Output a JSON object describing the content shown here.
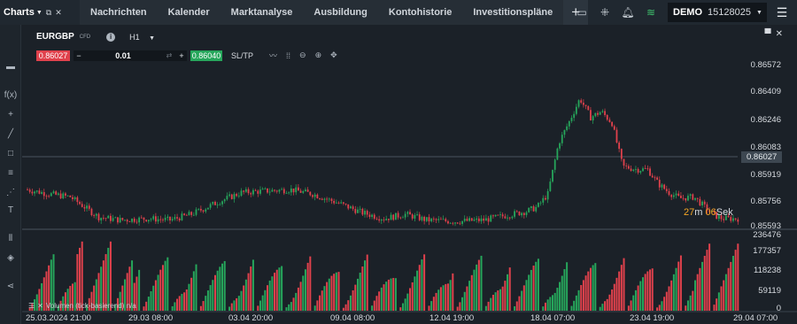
{
  "topbar": {
    "charts_label": "Charts",
    "tabs": [
      "Nachrichten",
      "Kalender",
      "Marktanalyse",
      "Ausbildung",
      "Kontohistorie",
      "Investitionspläne"
    ],
    "plus": "+",
    "account_mode": "DEMO",
    "account_number": "15128025"
  },
  "sidebar": {
    "fx_label": "f(x)"
  },
  "chart": {
    "symbol": "EURGBP",
    "symbol_type": "CFD",
    "timeframe": "H1",
    "sell_price": "0.86027",
    "buy_price": "0.86040",
    "volume_lot": "0.01",
    "sltp_label": "SL/TP",
    "current_price": "0.86027",
    "countdown_min": "27",
    "countdown_min_unit": "m",
    "countdown_sec": "06",
    "countdown_sec_unit": "Sek",
    "volume_indicator_label": "Volumen (tick-basierend) n/a",
    "colors": {
      "up": "#26a65b",
      "down": "#e0414c",
      "background": "#1b2128"
    }
  },
  "chart_data": {
    "type": "candlestick",
    "price_axis": [
      "0.86572",
      "0.86409",
      "0.86246",
      "0.86083",
      "0.85919",
      "0.85756",
      "0.85593"
    ],
    "volume_axis": [
      "236476",
      "177357",
      "118238",
      "59119",
      "0"
    ],
    "x_labels": [
      "25.03.2024 21:00",
      "29.03 08:00",
      "03.04 20:00",
      "09.04 08:00",
      "12.04 19:00",
      "18.04 07:00",
      "23.04 19:00",
      "29.04 07:00"
    ],
    "ylim": [
      0.855,
      0.8665
    ],
    "price_path": [
      [
        0.0,
        0.8578
      ],
      [
        0.03,
        0.8575
      ],
      [
        0.06,
        0.8573
      ],
      [
        0.08,
        0.8566
      ],
      [
        0.1,
        0.8559
      ],
      [
        0.13,
        0.8557
      ],
      [
        0.17,
        0.8558
      ],
      [
        0.2,
        0.8557
      ],
      [
        0.23,
        0.8561
      ],
      [
        0.27,
        0.857
      ],
      [
        0.3,
        0.8576
      ],
      [
        0.33,
        0.8577
      ],
      [
        0.37,
        0.8578
      ],
      [
        0.4,
        0.8575
      ],
      [
        0.44,
        0.8568
      ],
      [
        0.47,
        0.8562
      ],
      [
        0.5,
        0.8558
      ],
      [
        0.53,
        0.8561
      ],
      [
        0.56,
        0.8557
      ],
      [
        0.6,
        0.8556
      ],
      [
        0.64,
        0.8557
      ],
      [
        0.68,
        0.8561
      ],
      [
        0.7,
        0.8563
      ],
      [
        0.715,
        0.8566
      ],
      [
        0.73,
        0.8575
      ],
      [
        0.745,
        0.861
      ],
      [
        0.76,
        0.8625
      ],
      [
        0.775,
        0.8641
      ],
      [
        0.79,
        0.8628
      ],
      [
        0.805,
        0.8632
      ],
      [
        0.82,
        0.8624
      ],
      [
        0.835,
        0.8594
      ],
      [
        0.855,
        0.8592
      ],
      [
        0.87,
        0.8592
      ],
      [
        0.885,
        0.8582
      ],
      [
        0.9,
        0.8576
      ],
      [
        0.915,
        0.8572
      ],
      [
        0.935,
        0.8573
      ],
      [
        0.95,
        0.8566
      ],
      [
        0.965,
        0.856
      ],
      [
        0.975,
        0.8558
      ]
    ]
  }
}
